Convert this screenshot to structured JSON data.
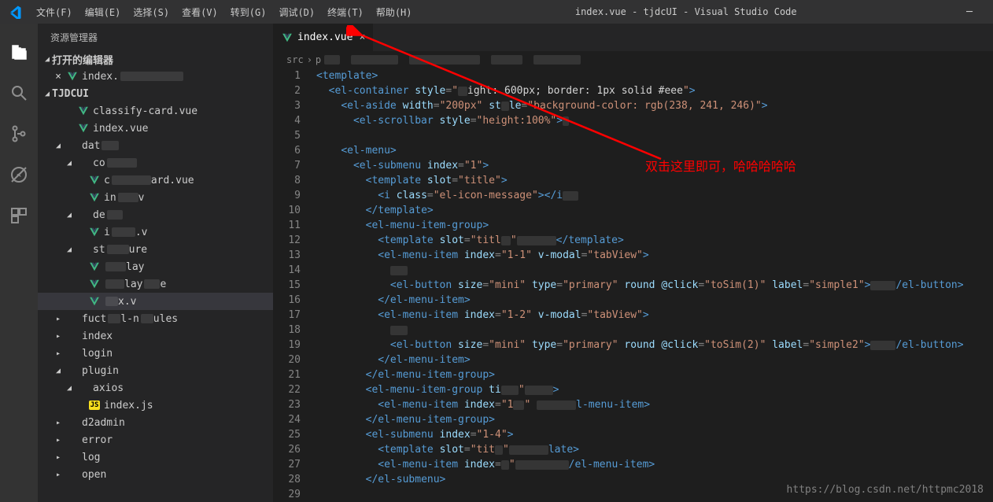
{
  "window_title": "index.vue - tjdcUI - Visual Studio Code",
  "menus": [
    "文件(F)",
    "编辑(E)",
    "选择(S)",
    "查看(V)",
    "转到(G)",
    "调试(D)",
    "终端(T)",
    "帮助(H)"
  ],
  "sidebar_title": "资源管理器",
  "sections": {
    "open_editors": "打开的编辑器",
    "project": "TJDCUI"
  },
  "tree": [
    {
      "kind": "section",
      "label": "打开的编辑器",
      "depth": 0,
      "expanded": true
    },
    {
      "kind": "open-file",
      "label": "index.",
      "depth": 1,
      "icon": "vue",
      "close": true,
      "blur": 80
    },
    {
      "kind": "section",
      "label": "TJDCUI",
      "depth": 0,
      "expanded": true
    },
    {
      "kind": "file",
      "label": "classify-card.vue",
      "depth": 2,
      "icon": "vue"
    },
    {
      "kind": "file",
      "label": "index.vue",
      "depth": 2,
      "icon": "vue"
    },
    {
      "kind": "folder",
      "label": "dat",
      "depth": 1,
      "expanded": true,
      "blur": 22
    },
    {
      "kind": "folder",
      "label": "co",
      "depth": 2,
      "expanded": true,
      "blur": 38
    },
    {
      "kind": "file",
      "label": "c",
      "depth": 3,
      "icon": "vue",
      "blur": 50,
      "suffix": "ard.vue"
    },
    {
      "kind": "file",
      "label": "in",
      "depth": 3,
      "icon": "vue",
      "blur": 26,
      "suffix": "v"
    },
    {
      "kind": "folder",
      "label": "de",
      "depth": 2,
      "expanded": true,
      "blur": 20
    },
    {
      "kind": "file",
      "label": "i",
      "depth": 3,
      "icon": "vue",
      "blur": 30,
      "suffix": ".v"
    },
    {
      "kind": "folder",
      "label": "st",
      "depth": 2,
      "expanded": true,
      "blur": 28,
      "suffix": "ure"
    },
    {
      "kind": "file",
      "label": "",
      "depth": 3,
      "icon": "vue",
      "blur": 26,
      "suffix": "lay"
    },
    {
      "kind": "file",
      "label": "",
      "depth": 3,
      "icon": "vue",
      "blur": 24,
      "suffix": "lay",
      "blur2": 20,
      "suffix2": "e"
    },
    {
      "kind": "file",
      "label": "",
      "depth": 3,
      "icon": "vue",
      "blur": 16,
      "suffix": "x.v",
      "hl": true
    },
    {
      "kind": "folder",
      "label": "fuct",
      "depth": 1,
      "expanded": false,
      "blur": 16,
      "suffix": "l-n",
      "blur2": 16,
      "suffix2": "ules"
    },
    {
      "kind": "folder",
      "label": "index",
      "depth": 1,
      "expanded": false
    },
    {
      "kind": "folder",
      "label": "login",
      "depth": 1,
      "expanded": false
    },
    {
      "kind": "folder",
      "label": "plugin",
      "depth": 1,
      "expanded": true
    },
    {
      "kind": "folder",
      "label": "axios",
      "depth": 2,
      "expanded": true
    },
    {
      "kind": "file",
      "label": "index.js",
      "depth": 3,
      "icon": "js"
    },
    {
      "kind": "folder",
      "label": "d2admin",
      "depth": 1,
      "expanded": false
    },
    {
      "kind": "folder",
      "label": "error",
      "depth": 1,
      "expanded": false
    },
    {
      "kind": "folder",
      "label": "log",
      "depth": 1,
      "expanded": false
    },
    {
      "kind": "folder",
      "label": "open",
      "depth": 1,
      "expanded": false
    }
  ],
  "tab": {
    "label": "index.vue"
  },
  "breadcrumb": [
    "src",
    "p"
  ],
  "annotation": "双击这里即可，哈哈哈哈哈",
  "watermark": "https://blog.csdn.net/httpmc2018",
  "code_lines": [
    [
      [
        "tag",
        "<template>"
      ]
    ],
    [
      [
        "sp",
        "  "
      ],
      [
        "tag",
        "<el-container "
      ],
      [
        "attr",
        "style"
      ],
      [
        "punc",
        "="
      ],
      [
        "str",
        "\""
      ],
      [
        "blur",
        12
      ],
      [
        "white",
        "ight: 600px; border: 1px solid #eee"
      ],
      [
        "str",
        "\""
      ],
      [
        "tag",
        ">"
      ]
    ],
    [
      [
        "sp",
        "    "
      ],
      [
        "tag",
        "<el-aside "
      ],
      [
        "attr",
        "width"
      ],
      [
        "punc",
        "="
      ],
      [
        "str",
        "\"200px\" "
      ],
      [
        "attr",
        "st"
      ],
      [
        "blur",
        10
      ],
      [
        "attr",
        "le"
      ],
      [
        "punc",
        "="
      ],
      [
        "str",
        "\"background-color: rgb(238, 241, 246)\""
      ],
      [
        "tag",
        ">"
      ]
    ],
    [
      [
        "sp",
        "      "
      ],
      [
        "tag",
        "<el-scrollbar "
      ],
      [
        "attr",
        "style"
      ],
      [
        "punc",
        "="
      ],
      [
        "str",
        "\"height:100%\""
      ],
      [
        "tag",
        ">"
      ],
      [
        "blur",
        8
      ]
    ],
    [],
    [
      [
        "sp",
        "    "
      ],
      [
        "tag",
        "<el-menu>"
      ]
    ],
    [
      [
        "sp",
        "      "
      ],
      [
        "tag",
        "<el-submenu "
      ],
      [
        "attr",
        "index"
      ],
      [
        "punc",
        "="
      ],
      [
        "str",
        "\"1\""
      ],
      [
        "tag",
        ">"
      ]
    ],
    [
      [
        "sp",
        "        "
      ],
      [
        "tag",
        "<template "
      ],
      [
        "attr",
        "slot"
      ],
      [
        "punc",
        "="
      ],
      [
        "str",
        "\"title\""
      ],
      [
        "tag",
        ">"
      ]
    ],
    [
      [
        "sp",
        "          "
      ],
      [
        "tag",
        "<i "
      ],
      [
        "attr",
        "class"
      ],
      [
        "punc",
        "="
      ],
      [
        "str",
        "\"el-icon-message\""
      ],
      [
        "tag",
        "></i"
      ],
      [
        "blur",
        20
      ]
    ],
    [
      [
        "sp",
        "        "
      ],
      [
        "tag",
        "</template>"
      ]
    ],
    [
      [
        "sp",
        "        "
      ],
      [
        "tag",
        "<el-menu-item-group>"
      ]
    ],
    [
      [
        "sp",
        "          "
      ],
      [
        "tag",
        "<template "
      ],
      [
        "attr",
        "slot"
      ],
      [
        "punc",
        "="
      ],
      [
        "str",
        "\"titl"
      ],
      [
        "blur",
        12
      ],
      [
        "str",
        "\""
      ],
      [
        "blur",
        50
      ],
      [
        "tag",
        "</template>"
      ]
    ],
    [
      [
        "sp",
        "          "
      ],
      [
        "tag",
        "<el-menu-item "
      ],
      [
        "attr",
        "index"
      ],
      [
        "punc",
        "="
      ],
      [
        "str",
        "\"1-1\" "
      ],
      [
        "attr",
        "v-modal"
      ],
      [
        "punc",
        "="
      ],
      [
        "str",
        "\"tabView\""
      ],
      [
        "tag",
        ">"
      ]
    ],
    [
      [
        "sp",
        "            "
      ],
      [
        "blur",
        22
      ]
    ],
    [
      [
        "sp",
        "            "
      ],
      [
        "tag",
        "<el-button "
      ],
      [
        "attr",
        "size"
      ],
      [
        "punc",
        "="
      ],
      [
        "str",
        "\"mini\" "
      ],
      [
        "attr",
        "type"
      ],
      [
        "punc",
        "="
      ],
      [
        "str",
        "\"primary\" "
      ],
      [
        "attr",
        "round "
      ],
      [
        "attr",
        "@click"
      ],
      [
        "punc",
        "="
      ],
      [
        "str",
        "\"toSim(1)\" "
      ],
      [
        "attr",
        "label"
      ],
      [
        "punc",
        "="
      ],
      [
        "str",
        "\"simple1\""
      ],
      [
        "tag",
        ">"
      ],
      [
        "blur",
        32
      ],
      [
        "tag",
        "/el-button>"
      ]
    ],
    [
      [
        "sp",
        "          "
      ],
      [
        "tag",
        "</el-menu-item>"
      ]
    ],
    [
      [
        "sp",
        "          "
      ],
      [
        "tag",
        "<el-menu-item "
      ],
      [
        "attr",
        "index"
      ],
      [
        "punc",
        "="
      ],
      [
        "str",
        "\"1-2\" "
      ],
      [
        "attr",
        "v-modal"
      ],
      [
        "punc",
        "="
      ],
      [
        "str",
        "\"tabView\""
      ],
      [
        "tag",
        ">"
      ]
    ],
    [
      [
        "sp",
        "            "
      ],
      [
        "blur",
        22
      ]
    ],
    [
      [
        "sp",
        "            "
      ],
      [
        "tag",
        "<el-button "
      ],
      [
        "attr",
        "size"
      ],
      [
        "punc",
        "="
      ],
      [
        "str",
        "\"mini\" "
      ],
      [
        "attr",
        "type"
      ],
      [
        "punc",
        "="
      ],
      [
        "str",
        "\"primary\" "
      ],
      [
        "attr",
        "round "
      ],
      [
        "attr",
        "@click"
      ],
      [
        "punc",
        "="
      ],
      [
        "str",
        "\"toSim(2)\" "
      ],
      [
        "attr",
        "label"
      ],
      [
        "punc",
        "="
      ],
      [
        "str",
        "\"simple2\""
      ],
      [
        "tag",
        ">"
      ],
      [
        "blur",
        32
      ],
      [
        "tag",
        "/el-button>"
      ]
    ],
    [
      [
        "sp",
        "          "
      ],
      [
        "tag",
        "</el-menu-item>"
      ]
    ],
    [
      [
        "sp",
        "        "
      ],
      [
        "tag",
        "</el-menu-item-group>"
      ]
    ],
    [
      [
        "sp",
        "        "
      ],
      [
        "tag",
        "<el-menu-item-group "
      ],
      [
        "attr",
        "ti"
      ],
      [
        "blur",
        22
      ],
      [
        "str",
        "\""
      ],
      [
        "blur",
        36
      ],
      [
        "tag",
        ">"
      ]
    ],
    [
      [
        "sp",
        "          "
      ],
      [
        "tag",
        "<el-menu-item "
      ],
      [
        "attr",
        "index"
      ],
      [
        "punc",
        "="
      ],
      [
        "str",
        "\"1"
      ],
      [
        "blur",
        14
      ],
      [
        "str",
        "\" "
      ],
      [
        "blur",
        50
      ],
      [
        "tag",
        "l-menu-item>"
      ]
    ],
    [
      [
        "sp",
        "        "
      ],
      [
        "tag",
        "</el-menu-item-group>"
      ]
    ],
    [
      [
        "sp",
        "        "
      ],
      [
        "tag",
        "<el-submenu "
      ],
      [
        "attr",
        "index"
      ],
      [
        "punc",
        "="
      ],
      [
        "str",
        "\"1-4\""
      ],
      [
        "tag",
        ">"
      ]
    ],
    [
      [
        "sp",
        "          "
      ],
      [
        "tag",
        "<template "
      ],
      [
        "attr",
        "slot"
      ],
      [
        "punc",
        "="
      ],
      [
        "str",
        "\"tit"
      ],
      [
        "blur",
        10
      ],
      [
        "str",
        "\""
      ],
      [
        "blur",
        50
      ],
      [
        "tag",
        "late>"
      ]
    ],
    [
      [
        "sp",
        "          "
      ],
      [
        "tag",
        "<el-menu-item "
      ],
      [
        "attr",
        "index"
      ],
      [
        "punc",
        "="
      ],
      [
        "blur",
        10
      ],
      [
        "str",
        "\""
      ],
      [
        "blur",
        68
      ],
      [
        "tag",
        "/el-menu-item>"
      ]
    ],
    [
      [
        "sp",
        "        "
      ],
      [
        "tag",
        "</el-submenu>"
      ]
    ],
    []
  ]
}
